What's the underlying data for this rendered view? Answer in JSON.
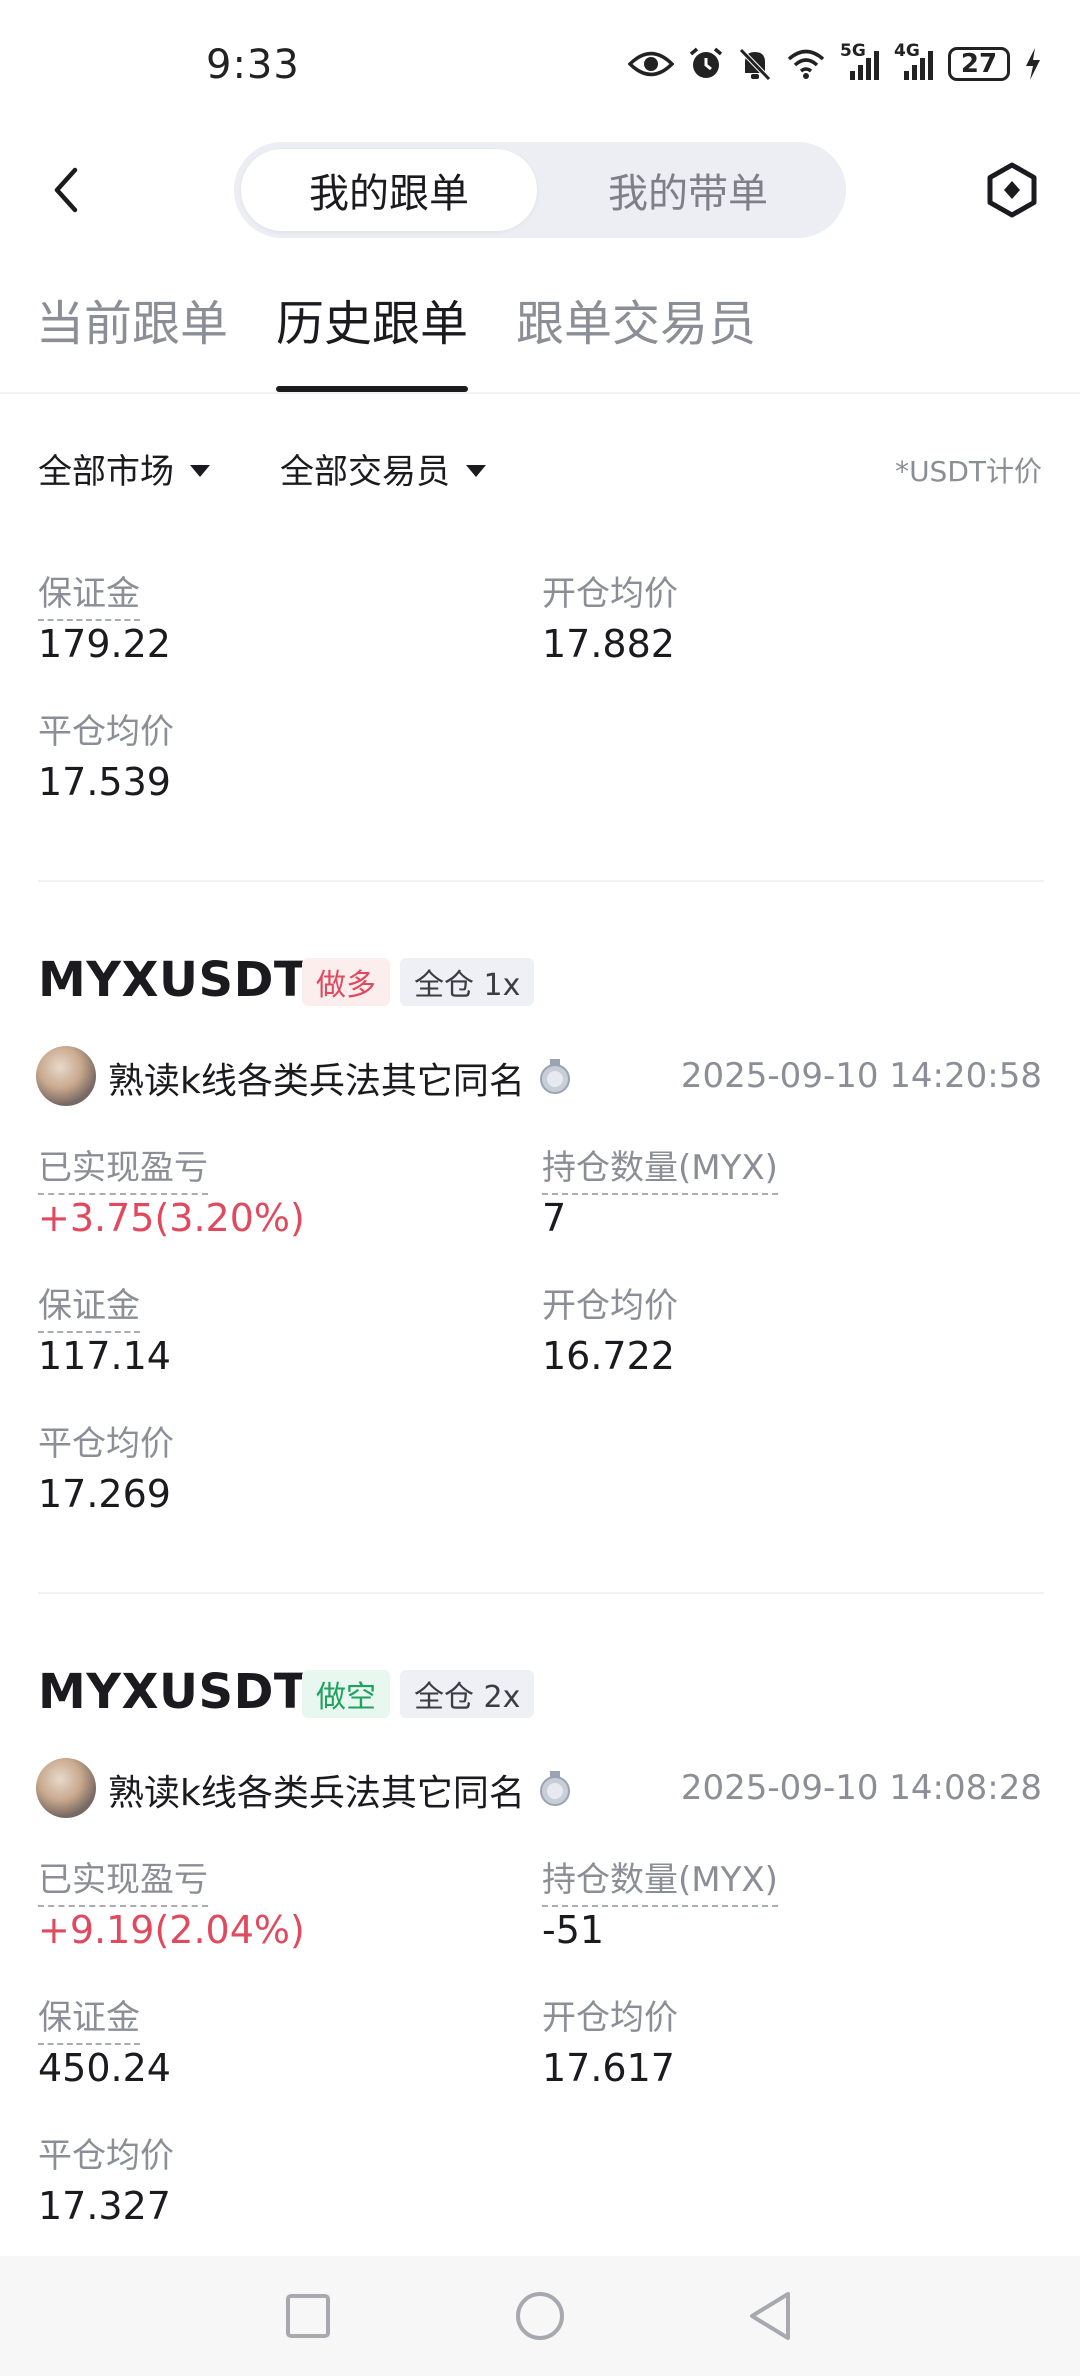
{
  "status_bar": {
    "time": "9:33",
    "net1": "5G",
    "net2": "4G",
    "battery": "27"
  },
  "header": {
    "seg_active": "我的跟单",
    "seg_inactive": "我的带单"
  },
  "tabs": [
    "当前跟单",
    "历史跟单",
    "跟单交易员"
  ],
  "filters": {
    "market": "全部市场",
    "trader": "全部交易员",
    "price_note": "*USDT计价"
  },
  "top_partial": {
    "margin_label": "保证金",
    "margin": "179.22",
    "open_label": "开仓均价",
    "open": "17.882",
    "close_label": "平仓均价",
    "close": "17.539"
  },
  "orders": [
    {
      "symbol": "MYXUSDT",
      "side": "做多",
      "margin_mode": "全仓 1x",
      "trader": "熟读k线各类兵法其它同名",
      "time": "2025-09-10 14:20:58",
      "pnl_label": "已实现盈亏",
      "pnl": "+3.75(3.20%)",
      "qty_label": "持仓数量(MYX)",
      "qty": "7",
      "margin_label": "保证金",
      "margin": "117.14",
      "open_label": "开仓均价",
      "open": "16.722",
      "close_label": "平仓均价",
      "close": "17.269"
    },
    {
      "symbol": "MYXUSDT",
      "side": "做空",
      "margin_mode": "全仓 2x",
      "trader": "熟读k线各类兵法其它同名",
      "time": "2025-09-10 14:08:28",
      "pnl_label": "已实现盈亏",
      "pnl": "+9.19(2.04%)",
      "qty_label": "持仓数量(MYX)",
      "qty": "-51",
      "margin_label": "保证金",
      "margin": "450.24",
      "open_label": "开仓均价",
      "open": "17.617",
      "close_label": "平仓均价",
      "close": "17.327"
    }
  ],
  "colors": {
    "profit": "#e04a5f",
    "long_tag": "#e04a5f",
    "short_tag": "#1fa160"
  }
}
